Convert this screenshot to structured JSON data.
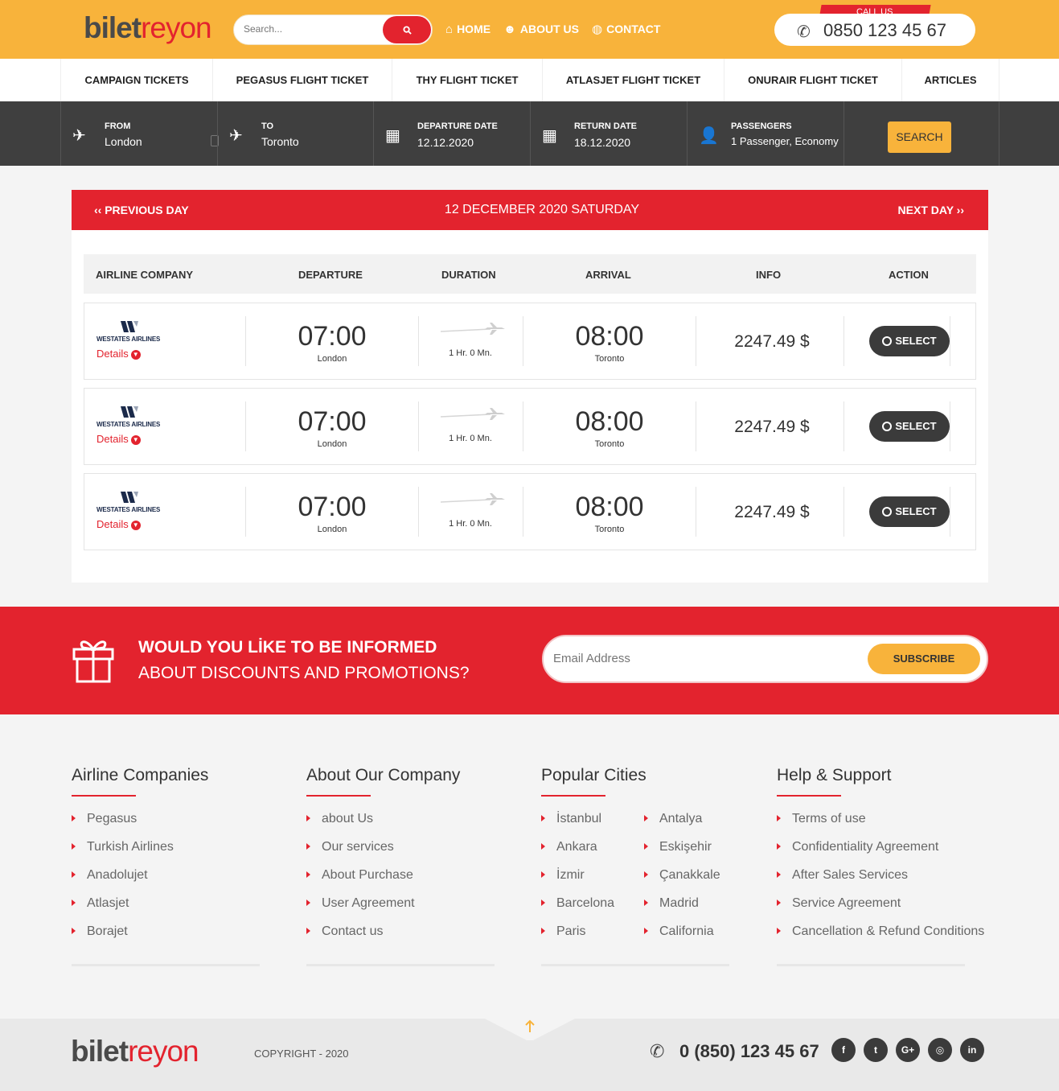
{
  "brand": {
    "logo_part1": "bilet",
    "logo_part2": "reyon"
  },
  "header": {
    "search_placeholder": "Search...",
    "search_icon": "search-icon",
    "nav": [
      {
        "label": "HOME",
        "icon": "home-icon"
      },
      {
        "label": "ABOUT US",
        "icon": "users-icon"
      },
      {
        "label": "CONTACT",
        "icon": "globe-icon"
      }
    ],
    "call_label": "CALL US",
    "phone": "0850 123 45 67"
  },
  "categories": [
    "CAMPAIGN TICKETS",
    "PEGASUS FLIGHT TICKET",
    "THY FLIGHT TICKET",
    "ATLASJET FLIGHT TICKET",
    "ONURAIR FLIGHT TICKET",
    "ARTICLES"
  ],
  "search_form": {
    "from_label": "FROM",
    "from_value": "London",
    "to_label": "TO",
    "to_value": "Toronto",
    "departure_label": "DEPARTURE DATE",
    "departure_value": "12.12.2020",
    "return_label": "RETURN DATE",
    "return_value": "18.12.2020",
    "passengers_label": "PASSENGERS",
    "passengers_value": "1 Passenger, Economy",
    "search_button": "SEARCH"
  },
  "day_nav": {
    "prev": "‹‹ PREVIOUS DAY",
    "current": "12 DECEMBER 2020 SATURDAY",
    "next": "NEXT DAY ››"
  },
  "table_headers": [
    "AIRLINE COMPANY",
    "DEPARTURE",
    "DURATION",
    "ARRIVAL",
    "INFO",
    "ACTION"
  ],
  "flights": [
    {
      "airline": "WESTATES AIRLINES",
      "details": "Details",
      "dep_time": "07:00",
      "dep_city": "London",
      "duration": "1 Hr. 0 Mn.",
      "arr_time": "08:00",
      "arr_city": "Toronto",
      "price": "2247.49 $",
      "action": "SELECT"
    },
    {
      "airline": "WESTATES AIRLINES",
      "details": "Details",
      "dep_time": "07:00",
      "dep_city": "London",
      "duration": "1 Hr. 0 Mn.",
      "arr_time": "08:00",
      "arr_city": "Toronto",
      "price": "2247.49 $",
      "action": "SELECT"
    },
    {
      "airline": "WESTATES AIRLINES",
      "details": "Details",
      "dep_time": "07:00",
      "dep_city": "London",
      "duration": "1 Hr. 0 Mn.",
      "arr_time": "08:00",
      "arr_city": "Toronto",
      "price": "2247.49 $",
      "action": "SELECT"
    }
  ],
  "newsletter": {
    "title": "WOULD YOU LİKE TO BE INFORMED",
    "subtitle": "ABOUT DISCOUNTS AND PROMOTIONS?",
    "placeholder": "Email Address",
    "button": "SUBSCRIBE"
  },
  "footer": {
    "airlines": {
      "title": "Airline Companies",
      "links": [
        "Pegasus",
        "Turkish Airlines",
        "Anadolujet",
        "Atlasjet",
        "Borajet"
      ]
    },
    "company": {
      "title": "About Our Company",
      "links": [
        "about Us",
        "Our services",
        "About Purchase",
        "User Agreement",
        "Contact us"
      ]
    },
    "cities": {
      "title": "Popular Cities",
      "col1": [
        "İstanbul",
        "Ankara",
        "İzmir",
        "Barcelona",
        "Paris"
      ],
      "col2": [
        "Antalya",
        "Eskişehir",
        "Çanakkale",
        "Madrid",
        "California"
      ]
    },
    "help": {
      "title": "Help & Support",
      "links": [
        "Terms of use",
        "Confidentiality Agreement",
        "After Sales Services",
        "Service Agreement",
        "Cancellation & Refund Conditions"
      ]
    },
    "copyright": "COPYRIGHT - 2020",
    "phone": "0 (850) 123 45 67",
    "social": [
      {
        "icon": "facebook-icon",
        "glyph": "f"
      },
      {
        "icon": "twitter-icon",
        "glyph": "t"
      },
      {
        "icon": "google-plus-icon",
        "glyph": "G+"
      },
      {
        "icon": "instagram-icon",
        "glyph": "◎"
      },
      {
        "icon": "linkedin-icon",
        "glyph": "in"
      }
    ]
  },
  "colors": {
    "primary_yellow": "#f8b33b",
    "primary_red": "#e3232e",
    "dark": "#3f3f3f"
  }
}
